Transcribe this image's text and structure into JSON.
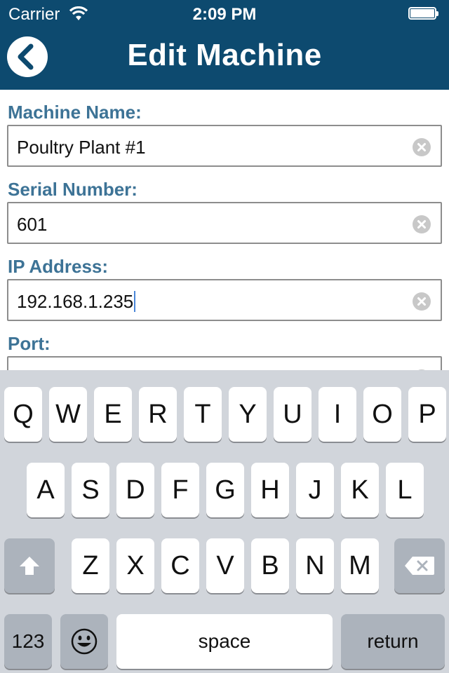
{
  "status": {
    "carrier": "Carrier",
    "time": "2:09 PM"
  },
  "nav": {
    "title": "Edit Machine",
    "back_icon": "chevron-left-icon"
  },
  "colors": {
    "nav_bg": "#0d4a6f",
    "label": "#3d7396",
    "keyboard_bg": "#d1d5db"
  },
  "form": {
    "machine_name": {
      "label": "Machine Name:",
      "value": "Poultry Plant #1"
    },
    "serial_number": {
      "label": "Serial Number:",
      "value": "601"
    },
    "ip_address": {
      "label": "IP Address:",
      "value": "192.168.1.235"
    },
    "port": {
      "label": "Port:",
      "value": ""
    }
  },
  "keyboard": {
    "row1": [
      "Q",
      "W",
      "E",
      "R",
      "T",
      "Y",
      "U",
      "I",
      "O",
      "P"
    ],
    "row2": [
      "A",
      "S",
      "D",
      "F",
      "G",
      "H",
      "J",
      "K",
      "L"
    ],
    "row3": [
      "Z",
      "X",
      "C",
      "V",
      "B",
      "N",
      "M"
    ],
    "numbers": "123",
    "space": "space",
    "return": "return"
  }
}
